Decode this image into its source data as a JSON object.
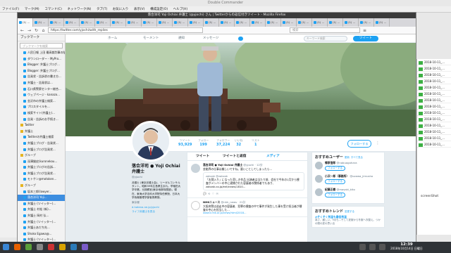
{
  "background_app": {
    "title": "Double Commander",
    "menu": [
      "ファイル(F)",
      "マーク(M)",
      "コマンド(C)",
      "ネットワーク(N)",
      "タブ(T)",
      "お気に入り",
      "表示(V)",
      "構成設定(O)",
      "ヘルプ(H)"
    ],
    "files": [
      "2018-10-11_...",
      "2018-10-11_...",
      "2018-10-11_...",
      "2018-10-11_...",
      "2018-10-11_...",
      "2018-10-11_...",
      "2018-10-11_...",
      "2018-10-11_...",
      "2018-10-11_...",
      "2018-10-11_...",
      "2018-10-11_...",
      "2018-10-11_...",
      "2018-10-11_...",
      "2018-10-11_..."
    ],
    "screenshot_label": "screenShot"
  },
  "browser": {
    "title": "落合洋司 Yoji Ochiai 弁護士 (@yjochi) さん | Twitterからの返信付きツイート - Mozilla Firefox",
    "tabs": [
      "(1) ...",
      "(1) ...",
      "(1) ...",
      "(1) ...",
      "(1) ...",
      "(1) ...",
      "(1) ...",
      "(1) ...",
      "(1) ...",
      "(1) ...",
      "(1) ...",
      "(1) ...",
      "(1) ...",
      "(1) ...",
      "(1) ...",
      "(1) ...",
      "(1) ...",
      "(1) ...",
      "(1) ...",
      "(1) ...",
      "(1) ...",
      "(1) ...",
      "(1) ...",
      "(1) ..."
    ],
    "url": "https://twitter.com/yjochi/with_replies",
    "search_placeholder": "検索"
  },
  "sidebar": {
    "header": "ブックマーク",
    "search_placeholder": "ブックマークを検索",
    "items": [
      {
        "label": "人民日報 上田 最高裁判事の陰に",
        "folder": false
      },
      {
        "label": "ダウンローダー - MyPro...",
        "folder": false
      },
      {
        "label": "Blogger: 弁護士ブログ...",
        "folder": false
      },
      {
        "label": "Blogger: 弁護士ブログ...",
        "folder": false
      },
      {
        "label": "告発状・告訴状の書き方...",
        "folder": false
      },
      {
        "label": "弁護士 - 告発状は...",
        "folder": false
      },
      {
        "label": "石川県警察センター総合...",
        "folder": false
      },
      {
        "label": "ウェブページ - kanazo...",
        "folder": false
      },
      {
        "label": "金沢市の弁護士検索...",
        "folder": false
      },
      {
        "label": "プロスタイルを...",
        "folder": false
      },
      {
        "label": "検索サイト(弁護士)...",
        "folder": false
      },
      {
        "label": "告発・告訴のお手続き...",
        "folder": false
      },
      {
        "label": "Twitter",
        "folder": true
      },
      {
        "label": "弁護士",
        "folder": true
      },
      {
        "label": "Twitterの弁護士検索",
        "folder": false
      },
      {
        "label": "弁護士ブログ・告発状...",
        "folder": false
      },
      {
        "label": "弁護士ブログ告発状...",
        "folder": false
      },
      {
        "label": "グループ",
        "folder": true
      },
      {
        "label": "深澤諭史(kuronekou...",
        "folder": false
      },
      {
        "label": "弁護士ブログの告訴...",
        "folder": false
      },
      {
        "label": "弁護士ブログ告発状...",
        "folder": false
      },
      {
        "label": "モトケン@motoken...",
        "folder": false
      },
      {
        "label": "グループ",
        "folder": true
      },
      {
        "label": "坂本三郎(lawyer...",
        "folder": false
      },
      {
        "label": "落合洋司 Yoji...",
        "folder": false
      },
      {
        "label": "弁護士 (ツイッター)...",
        "folder": false
      },
      {
        "label": "弁護士 村松 (新)...",
        "folder": false
      },
      {
        "label": "弁護士 岡村 弘...",
        "folder": false
      },
      {
        "label": "弁護士 (ツイッター)...",
        "folder": false
      },
      {
        "label": "弁護士あだち先...",
        "folder": false
      },
      {
        "label": "Shoko Egawa@...",
        "folder": false
      },
      {
        "label": "弁護士 (ツイッター)...",
        "folder": false
      }
    ],
    "selected_index": 24
  },
  "twitter": {
    "nav": {
      "home": "ホーム",
      "moments": "モーメント",
      "notifications": "通知",
      "messages": "メッセージ",
      "search_placeholder": "キーワード検索",
      "tweet_button": "ツイート"
    },
    "stats": [
      {
        "label": "ツイート",
        "value": "93,929"
      },
      {
        "label": "フォロー",
        "value": "199"
      },
      {
        "label": "フォロワー",
        "value": "37,224"
      },
      {
        "label": "いいね",
        "value": "32"
      },
      {
        "label": "リスト",
        "value": "1"
      }
    ],
    "follow_button": "フォローする",
    "profile": {
      "name": "落合洋司 ● Yoji Ochiai 弁護士",
      "handle": "@yjochi",
      "bio": "弁護士 (東京弁護士会)、リーガルコンサルタント。昭和39年広島県生まれ。早稲田大学卒業。元検察官(東京地検特捜部)。現在、東海大学法科大学院特任教授、日本大学危機管理学部客員教授。",
      "location": "東京都",
      "link": "d.hatena.ne.jp/yjochi",
      "joined": "ライフ弁護士を見る"
    },
    "timeline": {
      "tabs": [
        "ツイート",
        "ツイートと返信",
        "メディア"
      ],
      "tweets": [
        {
          "author": "落合洋司 ● Yoji Ochiai 弁護士",
          "handle": "@yjochi",
          "time": "12分",
          "text": "芸能界の仕事は厳しいですね。悪いことしてしまったら...",
          "quote_author": "zakzak @zakzak",
          "quote_text": "「お蔵入り」になった悲しき作品 出演者は当たり前、会社で今年の1月から捜査がメンバーの中に逮捕された容疑者の関係者でもあり、zakzak.co.jp/ent/news/1810..."
        },
        {
          "author": "NHKニュース",
          "handle": "@nhk_news",
          "time": "21分",
          "text": "大阪府警は逃走中の容疑者、犯罪の捜査の中で事件が発生した事を受け担当者が捜査の中心を担当した...",
          "link": "www3.nhk.or.jp/news/html/2018..."
        }
      ]
    },
    "suggestions": {
      "title": "おすすめユーザー",
      "refresh": "更新",
      "all": "すべて見る",
      "users": [
        {
          "name": "郷原信郎",
          "handle": "@nobuogohara",
          "follow": "フォローする"
        },
        {
          "name": "小沢一郎（事務所）",
          "handle": "@ozawa_jimusho",
          "follow": "フォローする"
        },
        {
          "name": "紀藤正樹",
          "handle": "@masaki_kito",
          "follow": "フォローする"
        }
      ]
    },
    "trends": {
      "title": "おすすめトレンド",
      "change": "変更する",
      "items": [
        {
          "tag": "#ぞくぞく気温も最低気温",
          "desc": "寒さ、厳しい。9月も...そして夏服から冬服へ衣替え。つかの間の夏の思い出"
        }
      ]
    }
  },
  "taskbar": {
    "time": "12:39",
    "date": "2018年10月14日 日曜日"
  }
}
